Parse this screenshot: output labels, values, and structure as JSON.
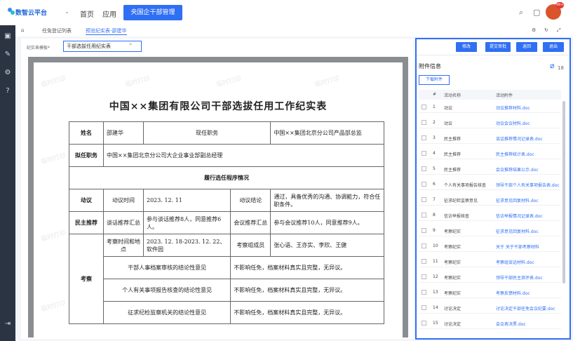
{
  "topbar": {
    "logo": "数智云平台",
    "nav": [
      "首页",
      "应用"
    ],
    "active_tab": "央国企干部管理",
    "badge": "99+"
  },
  "breadcrumb": [
    "任免登记列表",
    "预览纪实表-邵建华"
  ],
  "selector": {
    "label": "纪实表模板*",
    "value": "干部选拔任用纪实表"
  },
  "document": {
    "title": "中国××集团有限公司干部选拔任用工作纪实表",
    "watermark": "临时打印",
    "name_label": "姓名",
    "name_value": "邵建华",
    "current_post_label": "现任职务",
    "current_post_value": "中国××集团北京分公司产品部总监",
    "proposed_label": "拟任职务",
    "proposed_value": "中国××集团北京分公司大企业事业部副总经理",
    "procedure_header": "履行选任程序情况",
    "motion_label": "动议",
    "motion_time_label": "动议时间",
    "motion_time_value": "2023. 12. 11",
    "motion_conclusion_label": "动议结论",
    "motion_conclusion_value": "通过，具备优秀的沟通、协调能力，符合任职条件。",
    "recommend_label": "民主推荐",
    "talk_recommend_label": "谈话推荐汇总",
    "talk_recommend_value": "参与谈话推荐8人，同意推荐6人。",
    "meeting_recommend_label": "会议推荐汇总",
    "meeting_recommend_value": "参与会议推荐10人，同意推荐9人。",
    "inspect_label": "考察",
    "inspect_time_label": "考察时间和地点",
    "inspect_time_value": "2023. 12. 18-2023. 12. 22、软件园",
    "inspect_group_label": "考察组成员",
    "inspect_group_value": "张心语、王亦实、李欣、王健",
    "archive_label": "干部人事档案审核的结论性意见",
    "archive_value": "不影响任免，档案材料真实且完整，无异议。",
    "report_label": "个人有关事项报告核查的结论性意见",
    "report_value": "不影响任免，档案材料真实且完整，无异议。",
    "discipline_label": "征求纪检监察机关的结论性意见",
    "discipline_value": "不影响任免，档案材料真实且完整，无异议。"
  },
  "panel": {
    "buttons": [
      "修改",
      "提交审批",
      "返回",
      "退出"
    ],
    "title": "附件信息",
    "count": "18",
    "download": "下载附件",
    "col_no": "#",
    "col_type": "活动名称",
    "col_file": "活动附件",
    "rows": [
      {
        "no": "1",
        "type": "动议",
        "file": "动议推荐材料.doc"
      },
      {
        "no": "2",
        "type": "动议",
        "file": "动议会议材料.doc"
      },
      {
        "no": "3",
        "type": "民主推荐",
        "file": "谈话推荐情况记录表.doc"
      },
      {
        "no": "4",
        "type": "民主推荐",
        "file": "民主推荐统计表.doc"
      },
      {
        "no": "5",
        "type": "民主推荐",
        "file": "会议推荐结果公示.doc"
      },
      {
        "no": "6",
        "type": "个人有关事项报告核查",
        "file": "领导干部个人有关事项报告表.doc"
      },
      {
        "no": "7",
        "type": "征求纪检监察意见",
        "file": "征求意见回复材料.doc"
      },
      {
        "no": "8",
        "type": "信访举报核查",
        "file": "信访举报情况记录表.doc"
      },
      {
        "no": "9",
        "type": "考察纪实",
        "file": "征求意见回复材料.doc"
      },
      {
        "no": "10",
        "type": "考察纪实",
        "file": "关于        关于干部考察材料"
      },
      {
        "no": "11",
        "type": "考察纪实",
        "file": "考察组谈话材料.doc"
      },
      {
        "no": "12",
        "type": "考察纪实",
        "file": "领导干部民主测评表.doc"
      },
      {
        "no": "13",
        "type": "考察纪实",
        "file": "考察反馈材料.doc"
      },
      {
        "no": "14",
        "type": "讨论决定",
        "file": "讨论决定干部任免会议纪要.doc"
      },
      {
        "no": "15",
        "type": "讨论决定",
        "file": "会议表决票.doc"
      }
    ]
  }
}
